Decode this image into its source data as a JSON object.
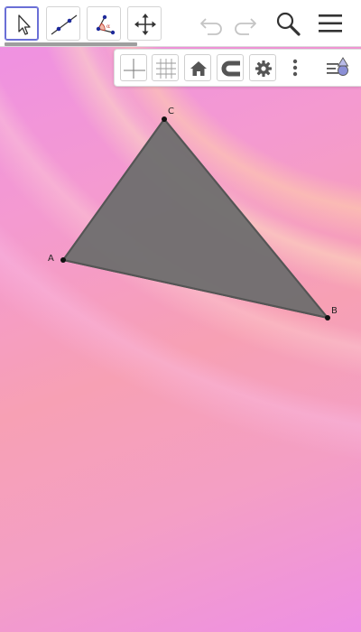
{
  "toolbar": {
    "tools": [
      {
        "name": "move-tool",
        "icon": "arrow-cursor-icon",
        "selected": true
      },
      {
        "name": "line-tool",
        "icon": "line-through-points-icon",
        "selected": false
      },
      {
        "name": "angle-tool",
        "icon": "angle-icon",
        "selected": false
      },
      {
        "name": "move-graphics-view-tool",
        "icon": "move-arrows-icon",
        "selected": false
      }
    ],
    "actions": [
      {
        "name": "undo-button",
        "icon": "undo-icon",
        "enabled": false
      },
      {
        "name": "redo-button",
        "icon": "redo-icon",
        "enabled": false
      },
      {
        "name": "search-button",
        "icon": "search-icon",
        "enabled": true
      },
      {
        "name": "main-menu-button",
        "icon": "hamburger-menu-icon",
        "enabled": true
      }
    ]
  },
  "style_bar": {
    "buttons": [
      {
        "name": "axes-toggle",
        "icon": "axes-icon"
      },
      {
        "name": "grid-toggle",
        "icon": "grid-icon"
      },
      {
        "name": "home-view",
        "icon": "home-icon"
      },
      {
        "name": "point-capturing",
        "icon": "magnet-capture-icon"
      },
      {
        "name": "graphics-settings",
        "icon": "gear-icon"
      },
      {
        "name": "more-options",
        "icon": "vertical-dots-icon"
      },
      {
        "name": "style-bar-toggle",
        "icon": "style-bar-menu-icon"
      }
    ]
  },
  "geometry": {
    "triangle": {
      "fill": "#6e6e6e",
      "stroke": "#555555",
      "fill_opacity": 0.95,
      "vertices": [
        {
          "label": "A"
        },
        {
          "label": "B"
        },
        {
          "label": "C"
        }
      ]
    }
  },
  "colors": {
    "selected_tool_border": "#6a6fd6",
    "toolbar_bg": "#ffffff",
    "icon_dark": "#333333",
    "icon_accent": "#1e2a9a",
    "disabled_icon": "#c4c4c4"
  }
}
